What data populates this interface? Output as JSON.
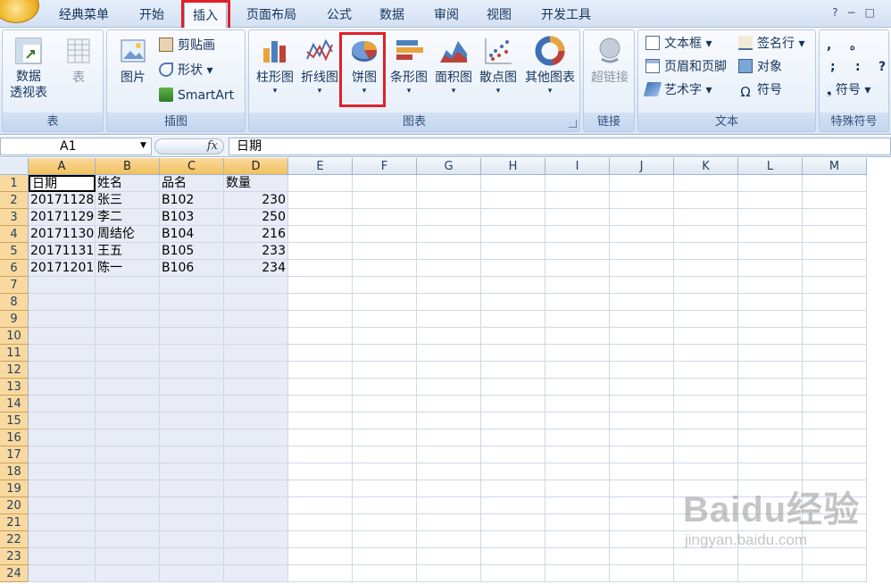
{
  "tabs": [
    {
      "label": "经典菜单",
      "active": false
    },
    {
      "label": "开始",
      "active": false
    },
    {
      "label": "插入",
      "active": true
    },
    {
      "label": "页面布局",
      "active": false
    },
    {
      "label": "公式",
      "active": false
    },
    {
      "label": "数据",
      "active": false
    },
    {
      "label": "审阅",
      "active": false
    },
    {
      "label": "视图",
      "active": false
    },
    {
      "label": "开发工具",
      "active": false
    }
  ],
  "window_controls": [
    "?",
    "−",
    "□"
  ],
  "ribbon": {
    "groups": {
      "table": {
        "label": "表",
        "pivot_line1": "数据",
        "pivot_line2": "透视表",
        "table": "表"
      },
      "illustrations": {
        "label": "插图",
        "picture": "图片",
        "clipart": "剪贴画",
        "shapes": "形状",
        "smartart": "SmartArt"
      },
      "charts": {
        "label": "图表",
        "column": "柱形图",
        "line": "折线图",
        "pie": "饼图",
        "bar": "条形图",
        "area": "面积图",
        "scatter": "散点图",
        "other": "其他图表"
      },
      "links": {
        "label": "链接",
        "hyperlink": "超链接"
      },
      "text": {
        "label": "文本",
        "textbox": "文本框",
        "header_footer": "页眉和页脚",
        "wordart": "艺术字",
        "signature": "签名行",
        "object": "对象",
        "symbol": "符号"
      },
      "special": {
        "label": "特殊符号",
        "sym1": ",",
        "sym2": "。",
        "sym3": ";",
        "sym4": ":",
        "sym5": "?",
        "symbol": "符号"
      }
    },
    "highlight_color": "#e0202a"
  },
  "formula_bar": {
    "name_box": "A1",
    "fx": "fx",
    "content": "日期"
  },
  "columns": [
    "A",
    "B",
    "C",
    "D",
    "E",
    "F",
    "G",
    "H",
    "I",
    "J",
    "K",
    "L",
    "M"
  ],
  "rows": [
    "1",
    "2",
    "3",
    "4",
    "5",
    "6",
    "7",
    "8",
    "9",
    "10",
    "11",
    "12",
    "13",
    "14",
    "15",
    "16",
    "17",
    "18",
    "19",
    "20",
    "21",
    "22",
    "23",
    "24"
  ],
  "sheet": {
    "headers": [
      "日期",
      "姓名",
      "品名",
      "数量"
    ],
    "records": [
      [
        "20171128",
        "张三",
        "B102",
        "230"
      ],
      [
        "20171129",
        "李二",
        "B103",
        "250"
      ],
      [
        "20171130",
        "周结伦",
        "B104",
        "216"
      ],
      [
        "20171131",
        "王五",
        "B105",
        "233"
      ],
      [
        "20171201",
        "陈一",
        "B106",
        "234"
      ]
    ]
  },
  "watermark": {
    "logo": "Baidu经验",
    "url": "jingyan.baidu.com"
  }
}
